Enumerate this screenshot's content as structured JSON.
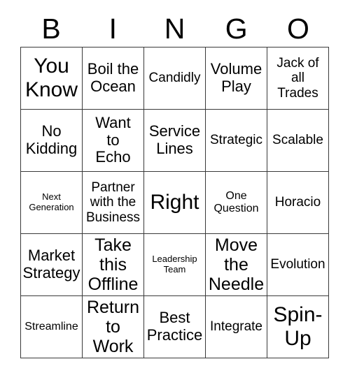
{
  "card": {
    "title": "BINGO Card",
    "header_letters": [
      "B",
      "I",
      "N",
      "G",
      "O"
    ],
    "rows": [
      [
        {
          "text": "You\nKnow",
          "size": "xxl"
        },
        {
          "text": "Boil the\nOcean",
          "size": "lg"
        },
        {
          "text": "Candidly",
          "size": "md"
        },
        {
          "text": "Volume\nPlay",
          "size": "lg"
        },
        {
          "text": "Jack of\nall\nTrades",
          "size": "md"
        }
      ],
      [
        {
          "text": "No\nKidding",
          "size": "lg"
        },
        {
          "text": "Want\nto\nEcho",
          "size": "lg"
        },
        {
          "text": "Service\nLines",
          "size": "lg"
        },
        {
          "text": "Strategic",
          "size": "md"
        },
        {
          "text": "Scalable",
          "size": "md"
        }
      ],
      [
        {
          "text": "Next\nGeneration",
          "size": "xs"
        },
        {
          "text": "Partner\nwith the\nBusiness",
          "size": "md"
        },
        {
          "text": "Right",
          "size": "xxl"
        },
        {
          "text": "One\nQuestion",
          "size": "sm"
        },
        {
          "text": "Horacio",
          "size": "md"
        }
      ],
      [
        {
          "text": "Market\nStrategy",
          "size": "lg"
        },
        {
          "text": "Take\nthis\nOffline",
          "size": "xl"
        },
        {
          "text": "Leadership\nTeam",
          "size": "xs"
        },
        {
          "text": "Move\nthe\nNeedle",
          "size": "xl"
        },
        {
          "text": "Evolution",
          "size": "md"
        }
      ],
      [
        {
          "text": "Streamline",
          "size": "sm"
        },
        {
          "text": "Return\nto\nWork",
          "size": "xl"
        },
        {
          "text": "Best\nPractice",
          "size": "lg"
        },
        {
          "text": "Integrate",
          "size": "md"
        },
        {
          "text": "Spin-\nUp",
          "size": "xxl"
        }
      ]
    ]
  },
  "colors": {
    "background": "#ffffff",
    "text": "#000000",
    "grid_line": "#3a3a3a"
  }
}
